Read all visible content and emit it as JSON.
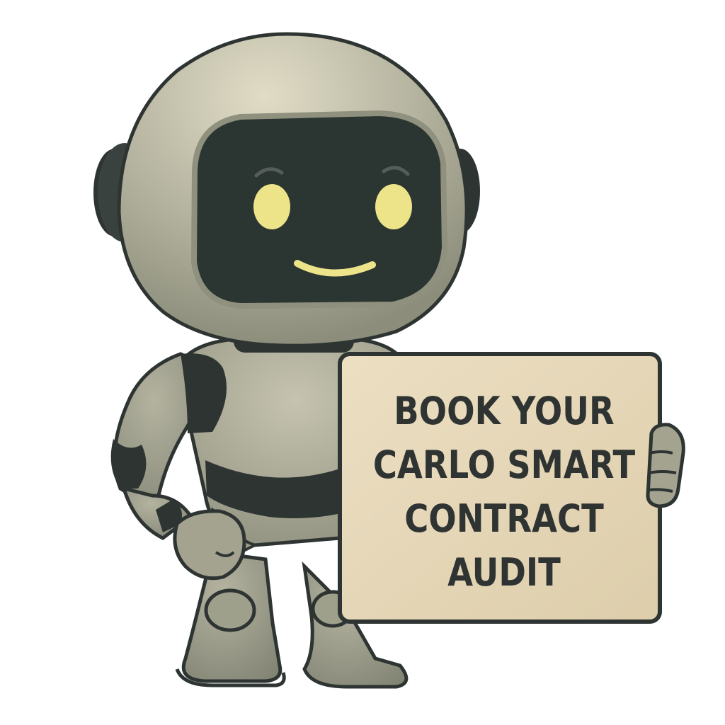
{
  "sign": {
    "lines": [
      "BOOK YOUR",
      "CARLO SMART",
      "CONTRACT",
      "AUDIT"
    ]
  },
  "colors": {
    "body": "#8d8f7c",
    "body_light": "#b7b6a2",
    "dark": "#2d3432",
    "visor": "#2b3532",
    "eyes": "#ede48a",
    "sign": "#e5d7b7"
  },
  "icons": [
    "robot-mascot",
    "sign-board"
  ]
}
